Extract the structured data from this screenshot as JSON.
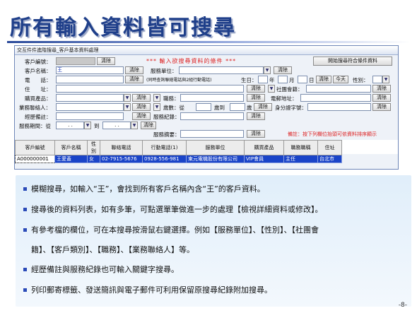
{
  "slide": {
    "title": "所有輸入資料皆可搜尋",
    "page_number": "-8-"
  },
  "window": {
    "title": "交互件件進階搜尋_客戶基本資料處理",
    "header_banner": "*** 輸入欲搜尋資料的條件 ***",
    "search_button": "開始搜尋符合條件資料",
    "hint": "備註：按下列欄位抬頭可依資料排序顯示"
  },
  "form": {
    "customer_id_label": "客戶編號：",
    "customer_name_label": "客戶名稱：",
    "customer_name_value": "王",
    "phone_label": "電　　話：",
    "phone_note": "(同時查詢聯絡電話與2組行動電話)",
    "address_label": "住　　址：",
    "product_label": "購買產品：",
    "sales_label": "業務聯絡人：",
    "remark_label": "經歷備註：",
    "service_date_label": "服務期間：從",
    "service_to_label": "到",
    "service_unit_label": "服務單位：",
    "birthday_label": "生日：",
    "year_label": "年",
    "month_label": "月",
    "day_label": "日",
    "today_label": "今天",
    "gender_label": "性別：",
    "community_label": "社團會籍：",
    "type_label": "客戶類別：",
    "job_label": "職務：",
    "email_label": "電郵地址：",
    "age_label": "歲數：從",
    "age_to_label": "歲到",
    "age_unit": "歲",
    "id_label": "身分證字號：",
    "service_record_label": "服務紀錄：",
    "service_summary_label": "服務摘要：",
    "clear": "清除",
    "date_placeholder": ". ."
  },
  "table": {
    "headers": [
      "客戶編號",
      "客戶名稱",
      "性別",
      "聯絡電話",
      "行動電話(1)",
      "服務單位",
      "購買產品",
      "職務職稱",
      "住址"
    ],
    "rows": [
      [
        "A000000001",
        "王愛蓋",
        "女",
        "02-7915-5676",
        "0928-556-981",
        "東元電機股份有限公司",
        "VIP會員",
        "主任",
        "台北市"
      ]
    ]
  },
  "bullets": [
    "模糊搜尋，如輸入“王”，會找到所有客戶名稱內含“王”的客戶資料。",
    "搜尋後的資料列表，如有多筆，可點選單筆做進一步的處理【檢視詳細資料或修改】。",
    "有參考檔的欄位，可在本搜尋按滑鼠右鍵選擇。例如【服務單位】、【性別】、【社團會",
    "籍】、【客戶類別】、【職務】、【業務聯絡人】等。",
    "經歷備註與服務紀錄也可輸入關鍵字搜尋。",
    "列印郵寄標籤、發送簡訊與電子郵件可利用保留原搜尋紀錄附加搜尋。"
  ],
  "colors": {
    "title": "#1f3f8a",
    "selected_row": "#1a44c8",
    "banner_red": "#dd2222",
    "bullet": "#2a4ab8"
  }
}
